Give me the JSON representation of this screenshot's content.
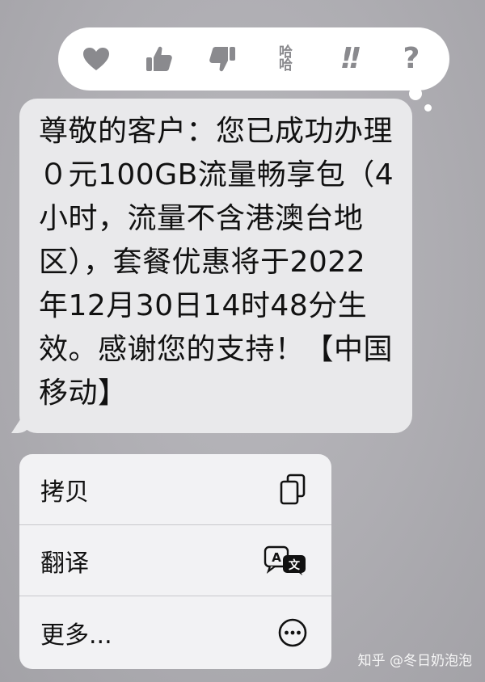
{
  "reactions": [
    {
      "icon": "heart-icon"
    },
    {
      "icon": "thumbs-up-icon"
    },
    {
      "icon": "thumbs-down-icon"
    },
    {
      "icon": "haha-icon",
      "text": "哈\n哈"
    },
    {
      "icon": "double-exclamation-icon",
      "text": "!!"
    },
    {
      "icon": "question-icon",
      "text": "?"
    }
  ],
  "message": {
    "text": "尊敬的客户：您已成功办理０元100GB流量畅享包（4小时，流量不含港澳台地区），套餐优惠将于2022年12月30日14时48分生效。感谢您的支持！【中国移动】"
  },
  "menu": {
    "items": [
      {
        "label": "拷贝",
        "icon": "copy-icon"
      },
      {
        "label": "翻译",
        "icon": "translate-icon"
      },
      {
        "label": "更多...",
        "icon": "more-icon"
      }
    ]
  },
  "watermark": "知乎 @冬日奶泡泡",
  "colors": {
    "bubble": "#e9e9eb",
    "reaction_icon": "#8a8a8e",
    "menu_bg": "#f2f2f4"
  }
}
